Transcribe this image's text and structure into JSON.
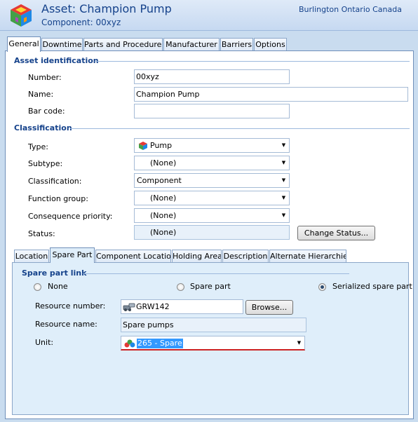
{
  "header": {
    "title": "Asset: Champion Pump",
    "subtitle": "Component:  00xyz",
    "location": "Burlington Ontario Canada"
  },
  "main_tabs": [
    {
      "label": "General",
      "active": true
    },
    {
      "label": "Downtime",
      "active": false
    },
    {
      "label": "Parts and Procedures",
      "active": false
    },
    {
      "label": "Manufacturer",
      "active": false
    },
    {
      "label": "Barriers",
      "active": false
    },
    {
      "label": "Options",
      "active": false
    }
  ],
  "asset_identification": {
    "section_title": "Asset identification",
    "number_label": "Number:",
    "number_value": "00xyz",
    "name_label": "Name:",
    "name_value": "Champion Pump",
    "barcode_label": "Bar code:",
    "barcode_value": ""
  },
  "classification": {
    "section_title": "Classification",
    "type_label": "Type:",
    "type_value": "Pump",
    "subtype_label": "Subtype:",
    "subtype_value": "(None)",
    "classification_label": "Classification:",
    "classification_value": "Component",
    "function_group_label": "Function group:",
    "function_group_value": "(None)",
    "consequence_label": "Consequence priority:",
    "consequence_value": "(None)",
    "status_label": "Status:",
    "status_value": "(None)",
    "change_status_label": "Change Status..."
  },
  "sub_tabs": [
    {
      "label": "Location",
      "active": false
    },
    {
      "label": "Spare Part",
      "active": true
    },
    {
      "label": "Component Location",
      "active": false
    },
    {
      "label": "Holding Area",
      "active": false
    },
    {
      "label": "Description",
      "active": false
    },
    {
      "label": "Alternate Hierarchies",
      "active": false
    }
  ],
  "spare_part": {
    "section_title": "Spare part link",
    "radio_none": "None",
    "radio_spare": "Spare part",
    "radio_serialized": "Serialized spare part",
    "selected_radio": "Serialized spare part",
    "resource_number_label": "Resource number:",
    "resource_number_value": "GRW142",
    "browse_label": "Browse...",
    "resource_name_label": "Resource name:",
    "resource_name_value": "Spare pumps",
    "unit_label": "Unit:",
    "unit_value": "265 - Spare"
  },
  "colors": {
    "accent": "#15428b",
    "background": "#c9dcef",
    "sub_panel": "#dfeefa",
    "unit_border": "#cc2222",
    "selection": "#3399ff"
  },
  "icons": [
    "app-cube-icon",
    "pump-cube-icon",
    "resource-icon",
    "unit-icon",
    "dropdown-arrow-icon"
  ]
}
